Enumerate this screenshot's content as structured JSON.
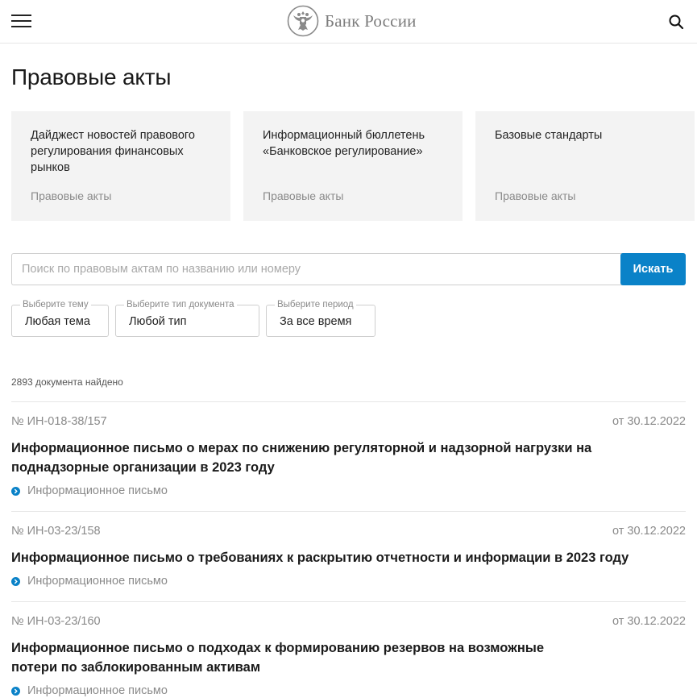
{
  "header": {
    "logo_text": "Банк России",
    "icons": {
      "menu": "hamburger-menu-icon",
      "search": "search-icon",
      "emblem": "double-eagle-emblem"
    }
  },
  "page_title": "Правовые акты",
  "cards": [
    {
      "title": "Дайджест новостей правового регулирования финансовых рынков",
      "tag": "Правовые акты"
    },
    {
      "title": "Информационный бюллетень «Банковское регулирование»",
      "tag": "Правовые акты"
    },
    {
      "title": "Базовые стандарты",
      "tag": "Правовые акты"
    }
  ],
  "search": {
    "placeholder": "Поиск по правовым актам по названию или номеру",
    "value": "",
    "button_label": "Искать"
  },
  "filters": [
    {
      "legend": "Выберите тему",
      "value": "Любая тема"
    },
    {
      "legend": "Выберите тип документа",
      "value": "Любой тип"
    },
    {
      "legend": "Выберите период",
      "value": "За все время"
    }
  ],
  "results_count": "2893 документа найдено",
  "documents": [
    {
      "number": "№ ИН-018-38/157",
      "date": "от 30.12.2022",
      "title": "Информационное письмо о мерах по снижению регуляторной и надзорной нагрузки на поднадзорные организации в 2023 году",
      "type": "Информационное письмо"
    },
    {
      "number": "№ ИН-03-23/158",
      "date": "от 30.12.2022",
      "title": "Информационное письмо о требованиях к раскрытию отчетности и информации в 2023 году",
      "type": "Информационное письмо"
    },
    {
      "number": "№ ИН-03-23/160",
      "date": "от 30.12.2022",
      "title": "Информационное письмо о подходах к формированию резервов на возможные потери по заблокированным активам",
      "type": "Информационное письмо"
    }
  ],
  "colors": {
    "accent": "#0a82c8",
    "muted_text": "#8a8a8a",
    "card_bg": "#f3f3f3"
  }
}
